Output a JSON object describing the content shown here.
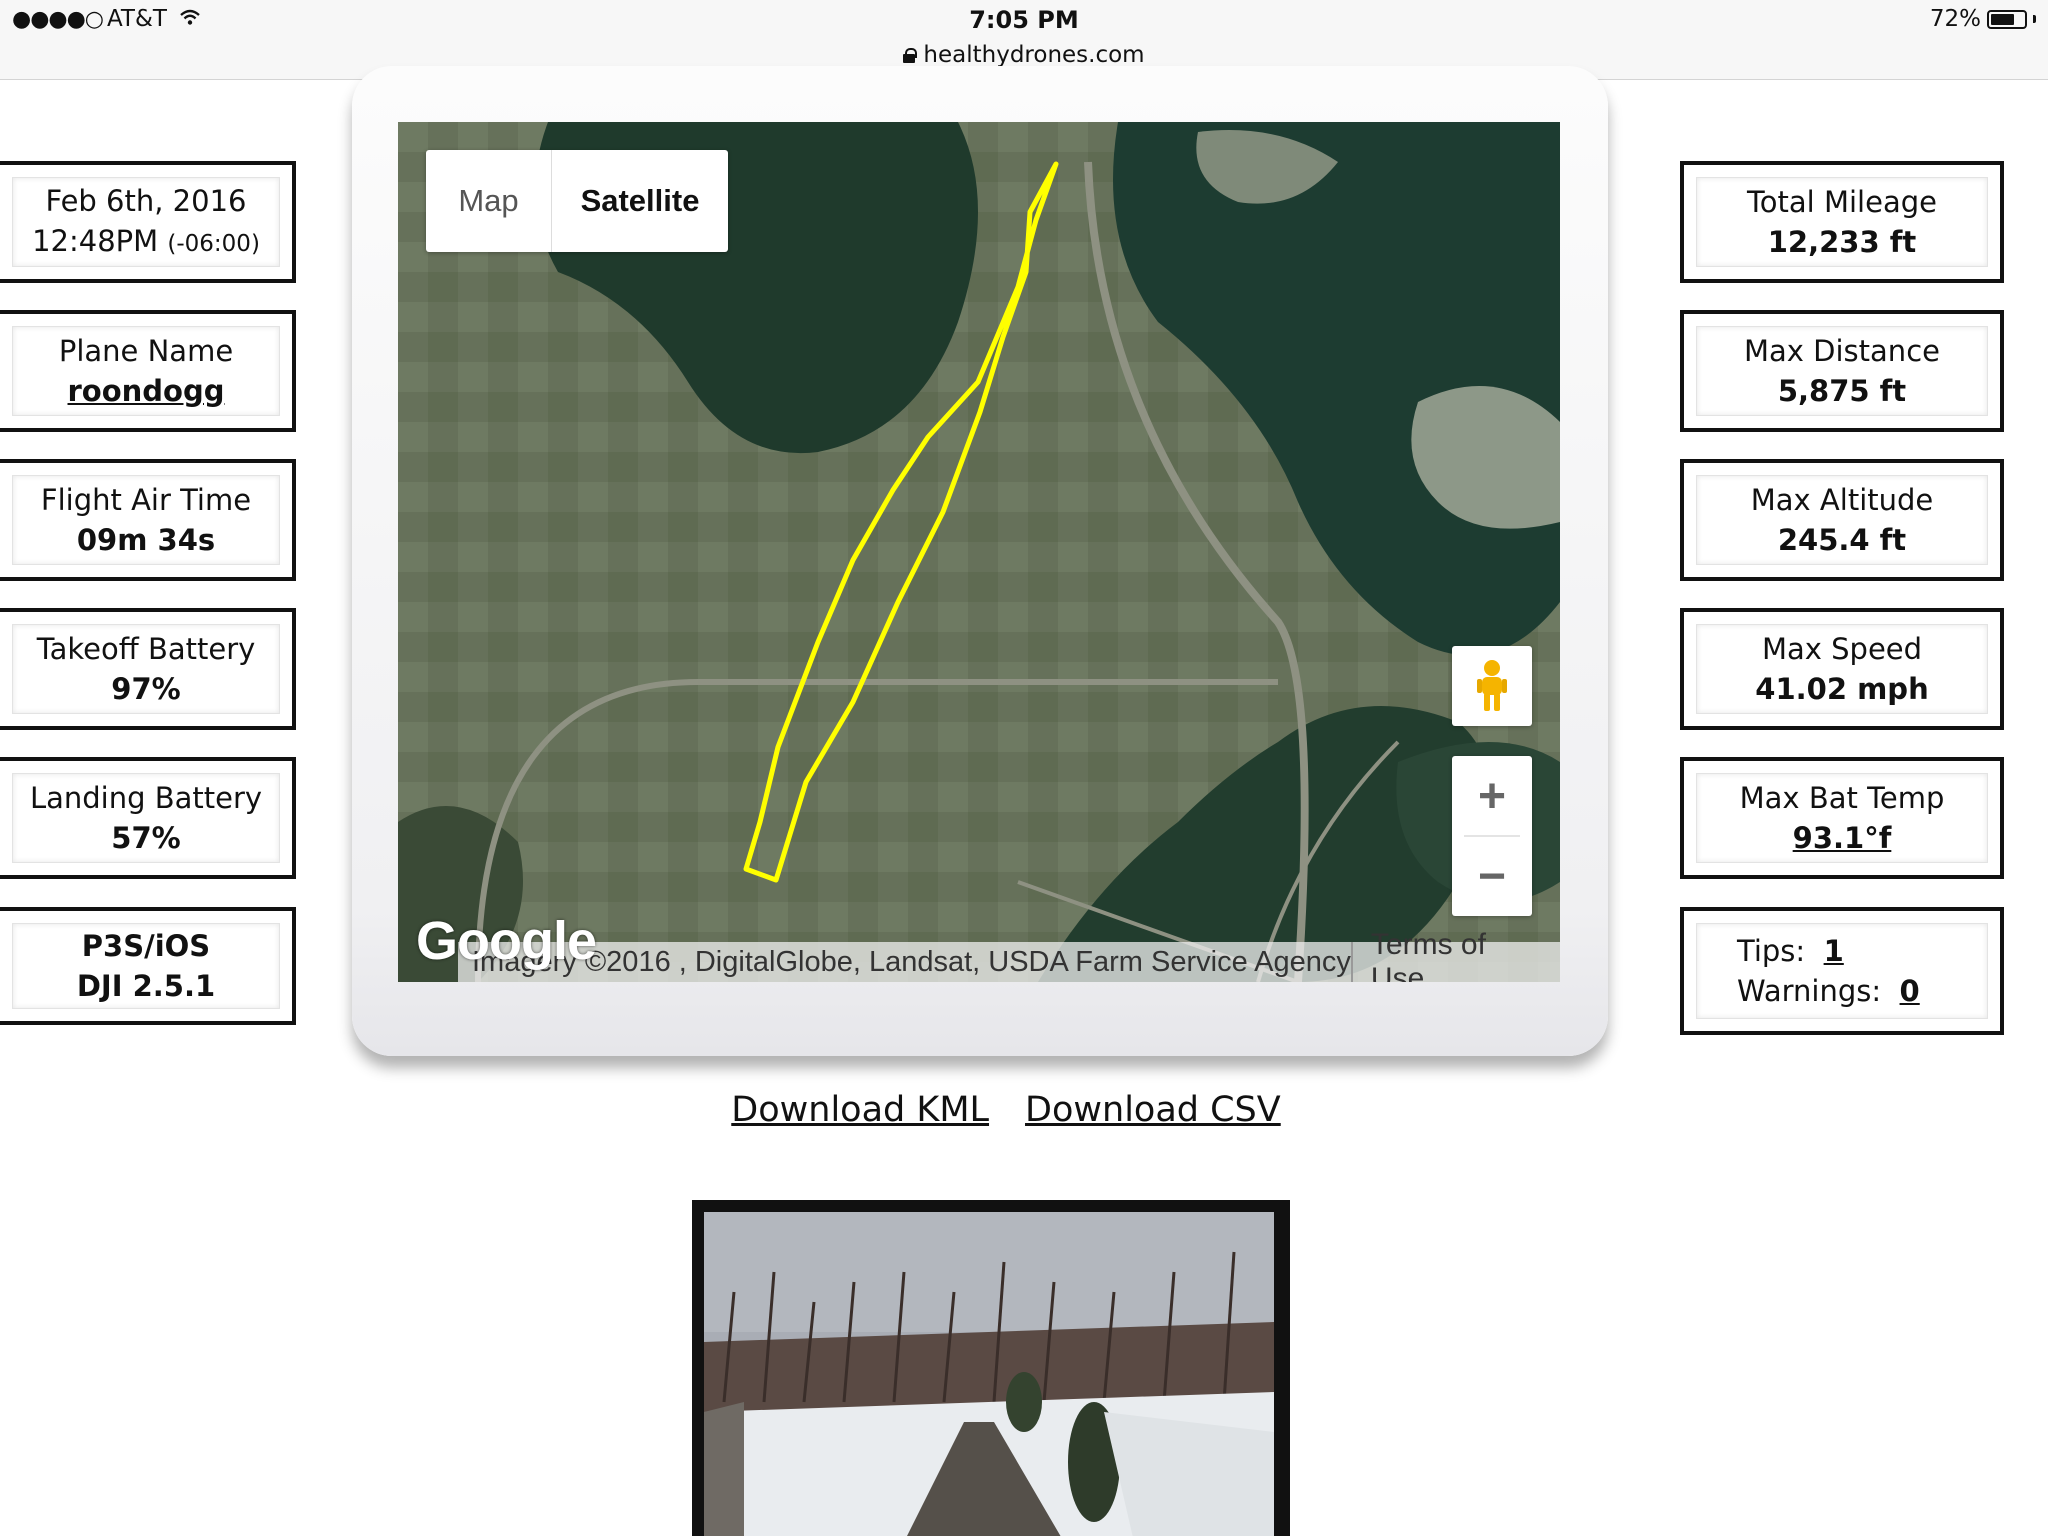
{
  "status_bar": {
    "signal": "●●●●○",
    "carrier": "AT&T",
    "wifi_icon": "wifi-icon",
    "time": "7:05 PM",
    "battery_percent": "72%",
    "battery_level": 0.72,
    "url": "healthydrones.com"
  },
  "left_stats": {
    "date": {
      "line1": "Feb 6th, 2016",
      "time": "12:48PM",
      "tz": "(-06:00)"
    },
    "plane": {
      "label": "Plane Name",
      "value": "roondogg"
    },
    "air_time": {
      "label": "Flight Air Time",
      "value": "09m 34s"
    },
    "takeoff": {
      "label": "Takeoff Battery",
      "value": "97%"
    },
    "landing": {
      "label": "Landing Battery",
      "value": "57%"
    },
    "platform": {
      "line1": "P3S/iOS",
      "line2": "DJI 2.5.1"
    }
  },
  "right_stats": {
    "mileage": {
      "label": "Total Mileage",
      "value": "12,233 ft"
    },
    "distance": {
      "label": "Max Distance",
      "value": "5,875 ft"
    },
    "altitude": {
      "label": "Max Altitude",
      "value": "245.4 ft"
    },
    "speed": {
      "label": "Max Speed",
      "value": "41.02 mph"
    },
    "bat_temp": {
      "label": "Max Bat Temp",
      "value": "93.1°f"
    },
    "tips": {
      "tips_label": "Tips:",
      "tips_value": "1",
      "warnings_label": "Warnings:",
      "warnings_value": "0"
    }
  },
  "map": {
    "type_map": "Map",
    "type_satellite": "Satellite",
    "selected": "Satellite",
    "zoom_in": "+",
    "zoom_out": "−",
    "google": "Google",
    "attribution": "Imagery ©2016 , DigitalGlobe, Landsat, USDA Farm Service Agency",
    "terms": "Terms of Use",
    "track_color": "#ffff00"
  },
  "downloads": {
    "kml": "Download KML",
    "csv": "Download CSV"
  }
}
